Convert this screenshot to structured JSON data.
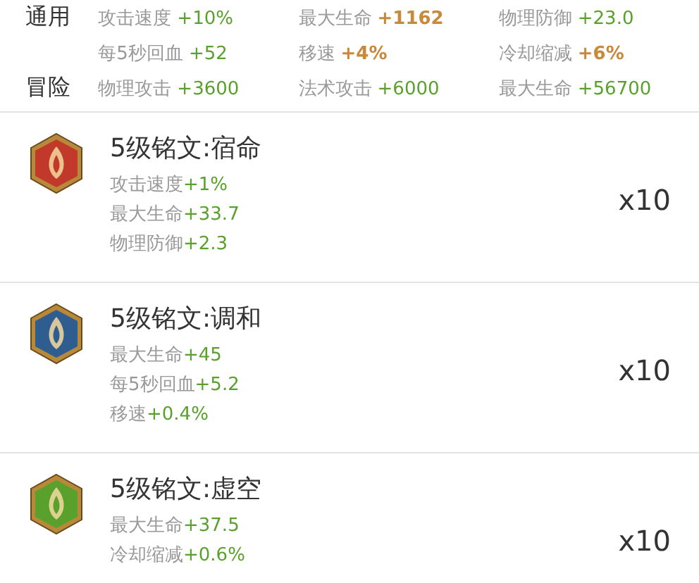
{
  "summary": [
    {
      "label": "通用",
      "stats": [
        {
          "name": "攻击速度",
          "value": "+10%",
          "highlight": false
        },
        {
          "name": "最大生命",
          "value": "+1162",
          "highlight": true
        },
        {
          "name": "物理防御",
          "value": "+23.0",
          "highlight": false
        }
      ]
    },
    {
      "stats": [
        {
          "name": "每5秒回血",
          "value": "+52",
          "highlight": false
        },
        {
          "name": "移速",
          "value": "+4%",
          "highlight": true
        },
        {
          "name": "冷却缩减",
          "value": "+6%",
          "highlight": true
        }
      ]
    },
    {
      "label": "冒险",
      "stats": [
        {
          "name": "物理攻击",
          "value": "+3600",
          "highlight": false
        },
        {
          "name": "法术攻击",
          "value": "+6000",
          "highlight": false
        },
        {
          "name": "最大生命",
          "value": "+56700",
          "highlight": false
        }
      ]
    }
  ],
  "inscriptions": [
    {
      "title": "5级铭文:宿命",
      "color": "#c0392b",
      "count": "x10",
      "stats": [
        {
          "name": "攻击速度",
          "value": "+1%"
        },
        {
          "name": "最大生命",
          "value": "+33.7"
        },
        {
          "name": "物理防御",
          "value": "+2.3"
        }
      ]
    },
    {
      "title": "5级铭文:调和",
      "color": "#2f5d8f",
      "count": "x10",
      "stats": [
        {
          "name": "最大生命",
          "value": "+45"
        },
        {
          "name": "每5秒回血",
          "value": "+5.2"
        },
        {
          "name": "移速",
          "value": "+0.4%"
        }
      ]
    },
    {
      "title": "5级铭文:虚空",
      "color": "#5aa02c",
      "count": "x10",
      "stats": [
        {
          "name": "最大生命",
          "value": "+37.5"
        },
        {
          "name": "冷却缩减",
          "value": "+0.6%"
        }
      ]
    }
  ]
}
